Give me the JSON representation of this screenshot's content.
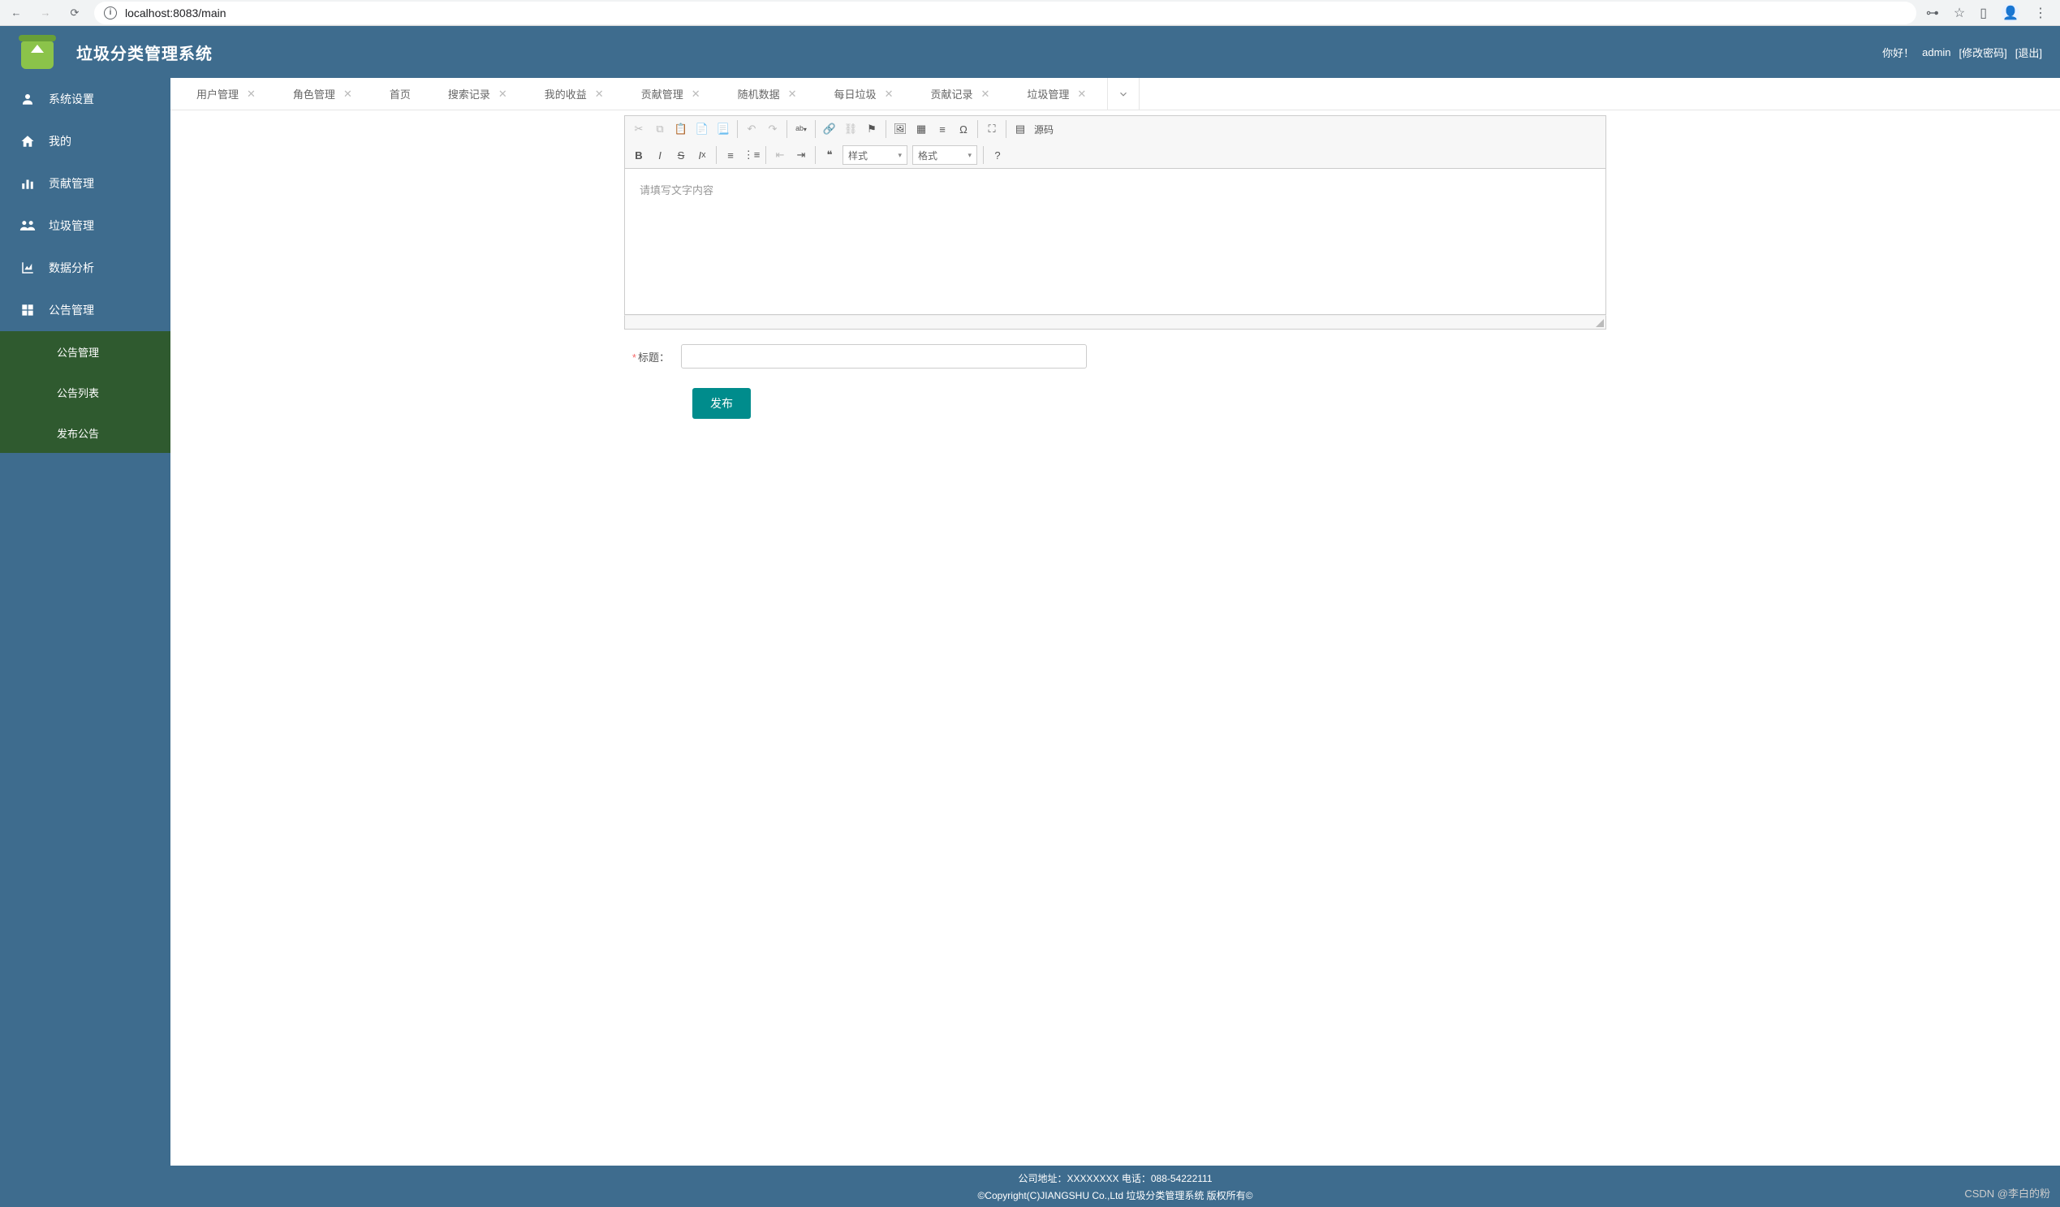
{
  "browser": {
    "url": "localhost:8083/main"
  },
  "header": {
    "title": "垃圾分类管理系统",
    "greeting": "你好！",
    "user": "admin",
    "change_pwd": "[修改密码]",
    "logout": "[退出]"
  },
  "sidebar": {
    "items": [
      {
        "label": "系统设置",
        "icon": "user"
      },
      {
        "label": "我的",
        "icon": "home"
      },
      {
        "label": "贡献管理",
        "icon": "chart"
      },
      {
        "label": "垃圾管理",
        "icon": "group"
      },
      {
        "label": "数据分析",
        "icon": "stats"
      },
      {
        "label": "公告管理",
        "icon": "grid"
      }
    ],
    "submenu": [
      {
        "label": "公告管理"
      },
      {
        "label": "公告列表"
      },
      {
        "label": "发布公告"
      }
    ]
  },
  "tabs": [
    {
      "label": "用户管理",
      "closable": true
    },
    {
      "label": "角色管理",
      "closable": true
    },
    {
      "label": "首页",
      "closable": false
    },
    {
      "label": "搜索记录",
      "closable": true
    },
    {
      "label": "我的收益",
      "closable": true
    },
    {
      "label": "贡献管理",
      "closable": true
    },
    {
      "label": "随机数据",
      "closable": true
    },
    {
      "label": "每日垃圾",
      "closable": true
    },
    {
      "label": "贡献记录",
      "closable": true
    },
    {
      "label": "垃圾管理",
      "closable": true
    }
  ],
  "editor": {
    "placeholder": "请填写文字内容",
    "style_sel": "样式",
    "format_sel": "格式",
    "source_label": "源码"
  },
  "form": {
    "title_label": "标题：",
    "title_value": "",
    "submit": "发布"
  },
  "footer": {
    "line1": "公司地址：XXXXXXXX 电话：088-54222111",
    "line2": "©Copyright(C)JIANGSHU Co.,Ltd 垃圾分类管理系统 版权所有©"
  },
  "watermark": "CSDN @李白的粉"
}
